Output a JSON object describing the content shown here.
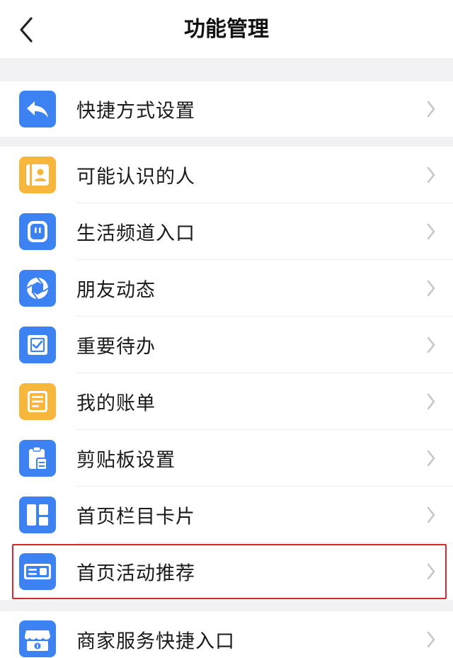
{
  "header": {
    "title": "功能管理"
  },
  "groups": [
    {
      "items": [
        {
          "label": "快捷方式设置",
          "icon": "reply-arrow-icon"
        }
      ]
    },
    {
      "items": [
        {
          "label": "可能认识的人",
          "icon": "contact-card-icon"
        },
        {
          "label": "生活频道入口",
          "icon": "life-channel-icon"
        },
        {
          "label": "朋友动态",
          "icon": "aperture-icon"
        },
        {
          "label": "重要待办",
          "icon": "todo-check-icon"
        },
        {
          "label": "我的账单",
          "icon": "bill-list-icon"
        },
        {
          "label": "剪贴板设置",
          "icon": "clipboard-icon"
        },
        {
          "label": "首页栏目卡片",
          "icon": "grid-cards-icon"
        },
        {
          "label": "首页活动推荐",
          "icon": "activity-card-icon"
        }
      ]
    },
    {
      "items": [
        {
          "label": "商家服务快捷入口",
          "icon": "merchant-store-icon"
        }
      ]
    }
  ],
  "colors": {
    "blue": "#3d82f3",
    "yellow": "#f6b73c",
    "highlight": "#d9272e"
  }
}
